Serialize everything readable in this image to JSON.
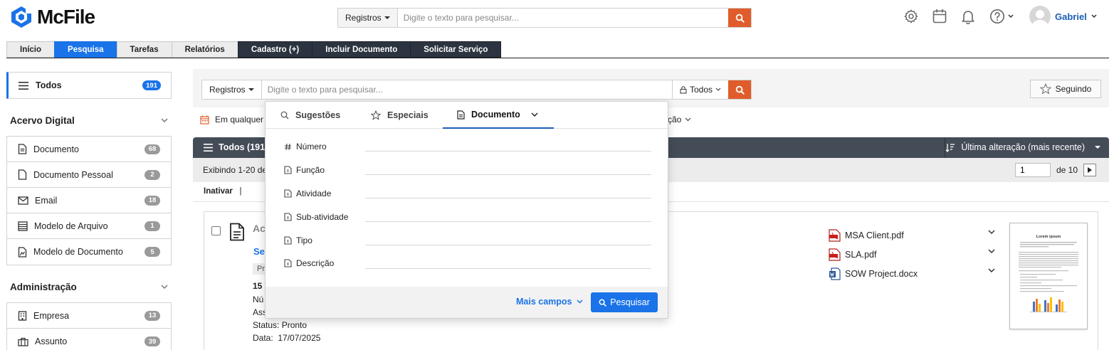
{
  "app": {
    "logo_text": "McFile",
    "brand_color": "#1a73e8",
    "accent_color": "#e05c2a"
  },
  "header": {
    "search": {
      "scope_label": "Registros",
      "placeholder": "Digite o texto para pesquisar..."
    },
    "icons": [
      "settings-icon",
      "calendar-icon",
      "bell-icon",
      "help-icon"
    ],
    "user_name": "Gabriel"
  },
  "nav": {
    "tabs": [
      {
        "label": "Início",
        "active": false,
        "style": "light"
      },
      {
        "label": "Pesquisa",
        "active": true,
        "style": "light"
      },
      {
        "label": "Tarefas",
        "active": false,
        "style": "light"
      },
      {
        "label": "Relatórios",
        "active": false,
        "style": "light"
      },
      {
        "label": "Cadastro (+)",
        "active": false,
        "style": "dark"
      },
      {
        "label": "Incluir Documento",
        "active": false,
        "style": "dark"
      },
      {
        "label": "Solicitar Serviço",
        "active": false,
        "style": "dark"
      }
    ]
  },
  "sidebar": {
    "todos": {
      "label": "Todos",
      "count": "191"
    },
    "sections": [
      {
        "title": "Acervo Digital",
        "items": [
          {
            "label": "Documento",
            "count": "68",
            "icon": "document-icon"
          },
          {
            "label": "Documento Pessoal",
            "count": "2",
            "icon": "personal-document-icon"
          },
          {
            "label": "Email",
            "count": "18",
            "icon": "email-icon"
          },
          {
            "label": "Modelo de Arquivo",
            "count": "1",
            "icon": "file-template-icon"
          },
          {
            "label": "Modelo de Documento",
            "count": "5",
            "icon": "document-template-icon"
          }
        ]
      },
      {
        "title": "Administração",
        "items": [
          {
            "label": "Empresa",
            "count": "13",
            "icon": "building-icon"
          },
          {
            "label": "Assunto",
            "count": "39",
            "icon": "briefcase-icon"
          }
        ]
      }
    ]
  },
  "main": {
    "search": {
      "scope_label": "Registros",
      "placeholder": "Digite o texto para pesquisar...",
      "access_label": "Todos"
    },
    "follow_label": "Seguindo",
    "filter_left": "Em qualquer",
    "filter_right": "ção",
    "list_header": {
      "title": "Todos (191",
      "sort_label": "Última alteração (mais recente)"
    },
    "info": {
      "text": "Exibindo 1-20 de",
      "page_value": "1",
      "of_label": "de 10"
    },
    "action": {
      "label": "Inativar",
      "divider": "|"
    },
    "result": {
      "title_fragment": "Ac",
      "link_fragment": "Se",
      "pill_fragment": "Pr",
      "number_fragment": "15",
      "line_a": "Nú",
      "line_b": "Ass",
      "status_label": "Status:",
      "status_value": "Pronto",
      "date_label": "Data:",
      "date_value": "17/07/2025",
      "files": [
        {
          "name": "MSA Client.pdf",
          "icon": "pdf-icon"
        },
        {
          "name": "SLA.pdf",
          "icon": "pdf-icon"
        },
        {
          "name": "SOW Project.docx",
          "icon": "word-icon"
        }
      ],
      "thumbnail_title": "Lorem ipsum"
    }
  },
  "dropdown": {
    "tabs": [
      {
        "label": "Sugestões",
        "icon": "search-icon",
        "active": false
      },
      {
        "label": "Especiais",
        "icon": "star-icon",
        "active": false
      },
      {
        "label": "Documento",
        "icon": "document-icon",
        "active": true
      }
    ],
    "fields": [
      {
        "label": "Número",
        "icon": "hash-icon"
      },
      {
        "label": "Função",
        "icon": "field-doc-icon"
      },
      {
        "label": "Atividade",
        "icon": "field-doc-icon"
      },
      {
        "label": "Sub-atividade",
        "icon": "field-doc-icon"
      },
      {
        "label": "Tipo",
        "icon": "field-doc-icon"
      },
      {
        "label": "Descrição",
        "icon": "field-doc-icon"
      }
    ],
    "more_fields_label": "Mais campos",
    "search_button_label": "Pesquisar"
  }
}
